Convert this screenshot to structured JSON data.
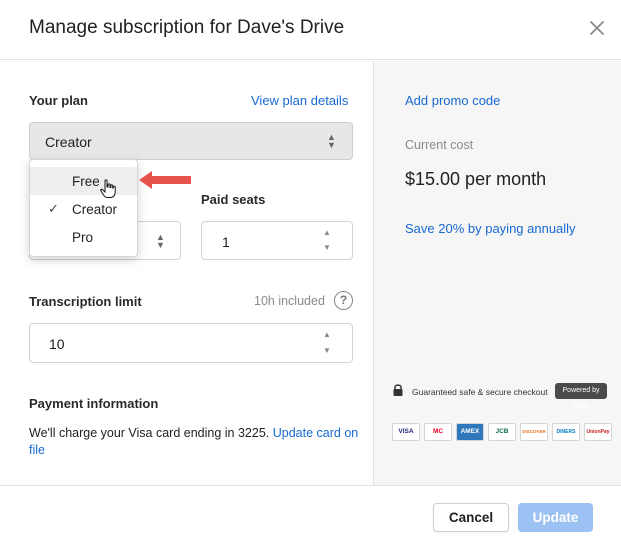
{
  "dialog": {
    "title": "Manage subscription for Dave's Drive"
  },
  "plan": {
    "label": "Your plan",
    "details_link": "View plan details",
    "selected": "Creator",
    "options": [
      "Free",
      "Creator",
      "Pro"
    ],
    "checked_option": "Creator",
    "hovered_option": "Free"
  },
  "seats": {
    "label": "Paid seats",
    "value": "1"
  },
  "transcription": {
    "label": "Transcription limit",
    "included": "10h included",
    "help_glyph": "?",
    "value": "10"
  },
  "payment": {
    "label": "Payment information",
    "text": "We'll charge your Visa card ending in 3225.",
    "update_link": "Update card on file"
  },
  "summary": {
    "promo_link": "Add promo code",
    "cost_label": "Current cost",
    "cost_value": "$15.00 per month",
    "annual_link": "Save 20% by paying annually"
  },
  "checkout": {
    "secure_text": "Guaranteed safe & secure checkout",
    "stripe_badge": "Powered by stripe",
    "cards": [
      "VISA",
      "MC",
      "AMEX",
      "JCB",
      "DISCOVER",
      "DINERS",
      "UnionPay"
    ]
  },
  "footer": {
    "cancel_label": "Cancel",
    "update_label": "Update"
  },
  "colors": {
    "link": "#1769d1",
    "update_button": "#9cc2f3",
    "annotation_arrow": "#e5534b"
  }
}
